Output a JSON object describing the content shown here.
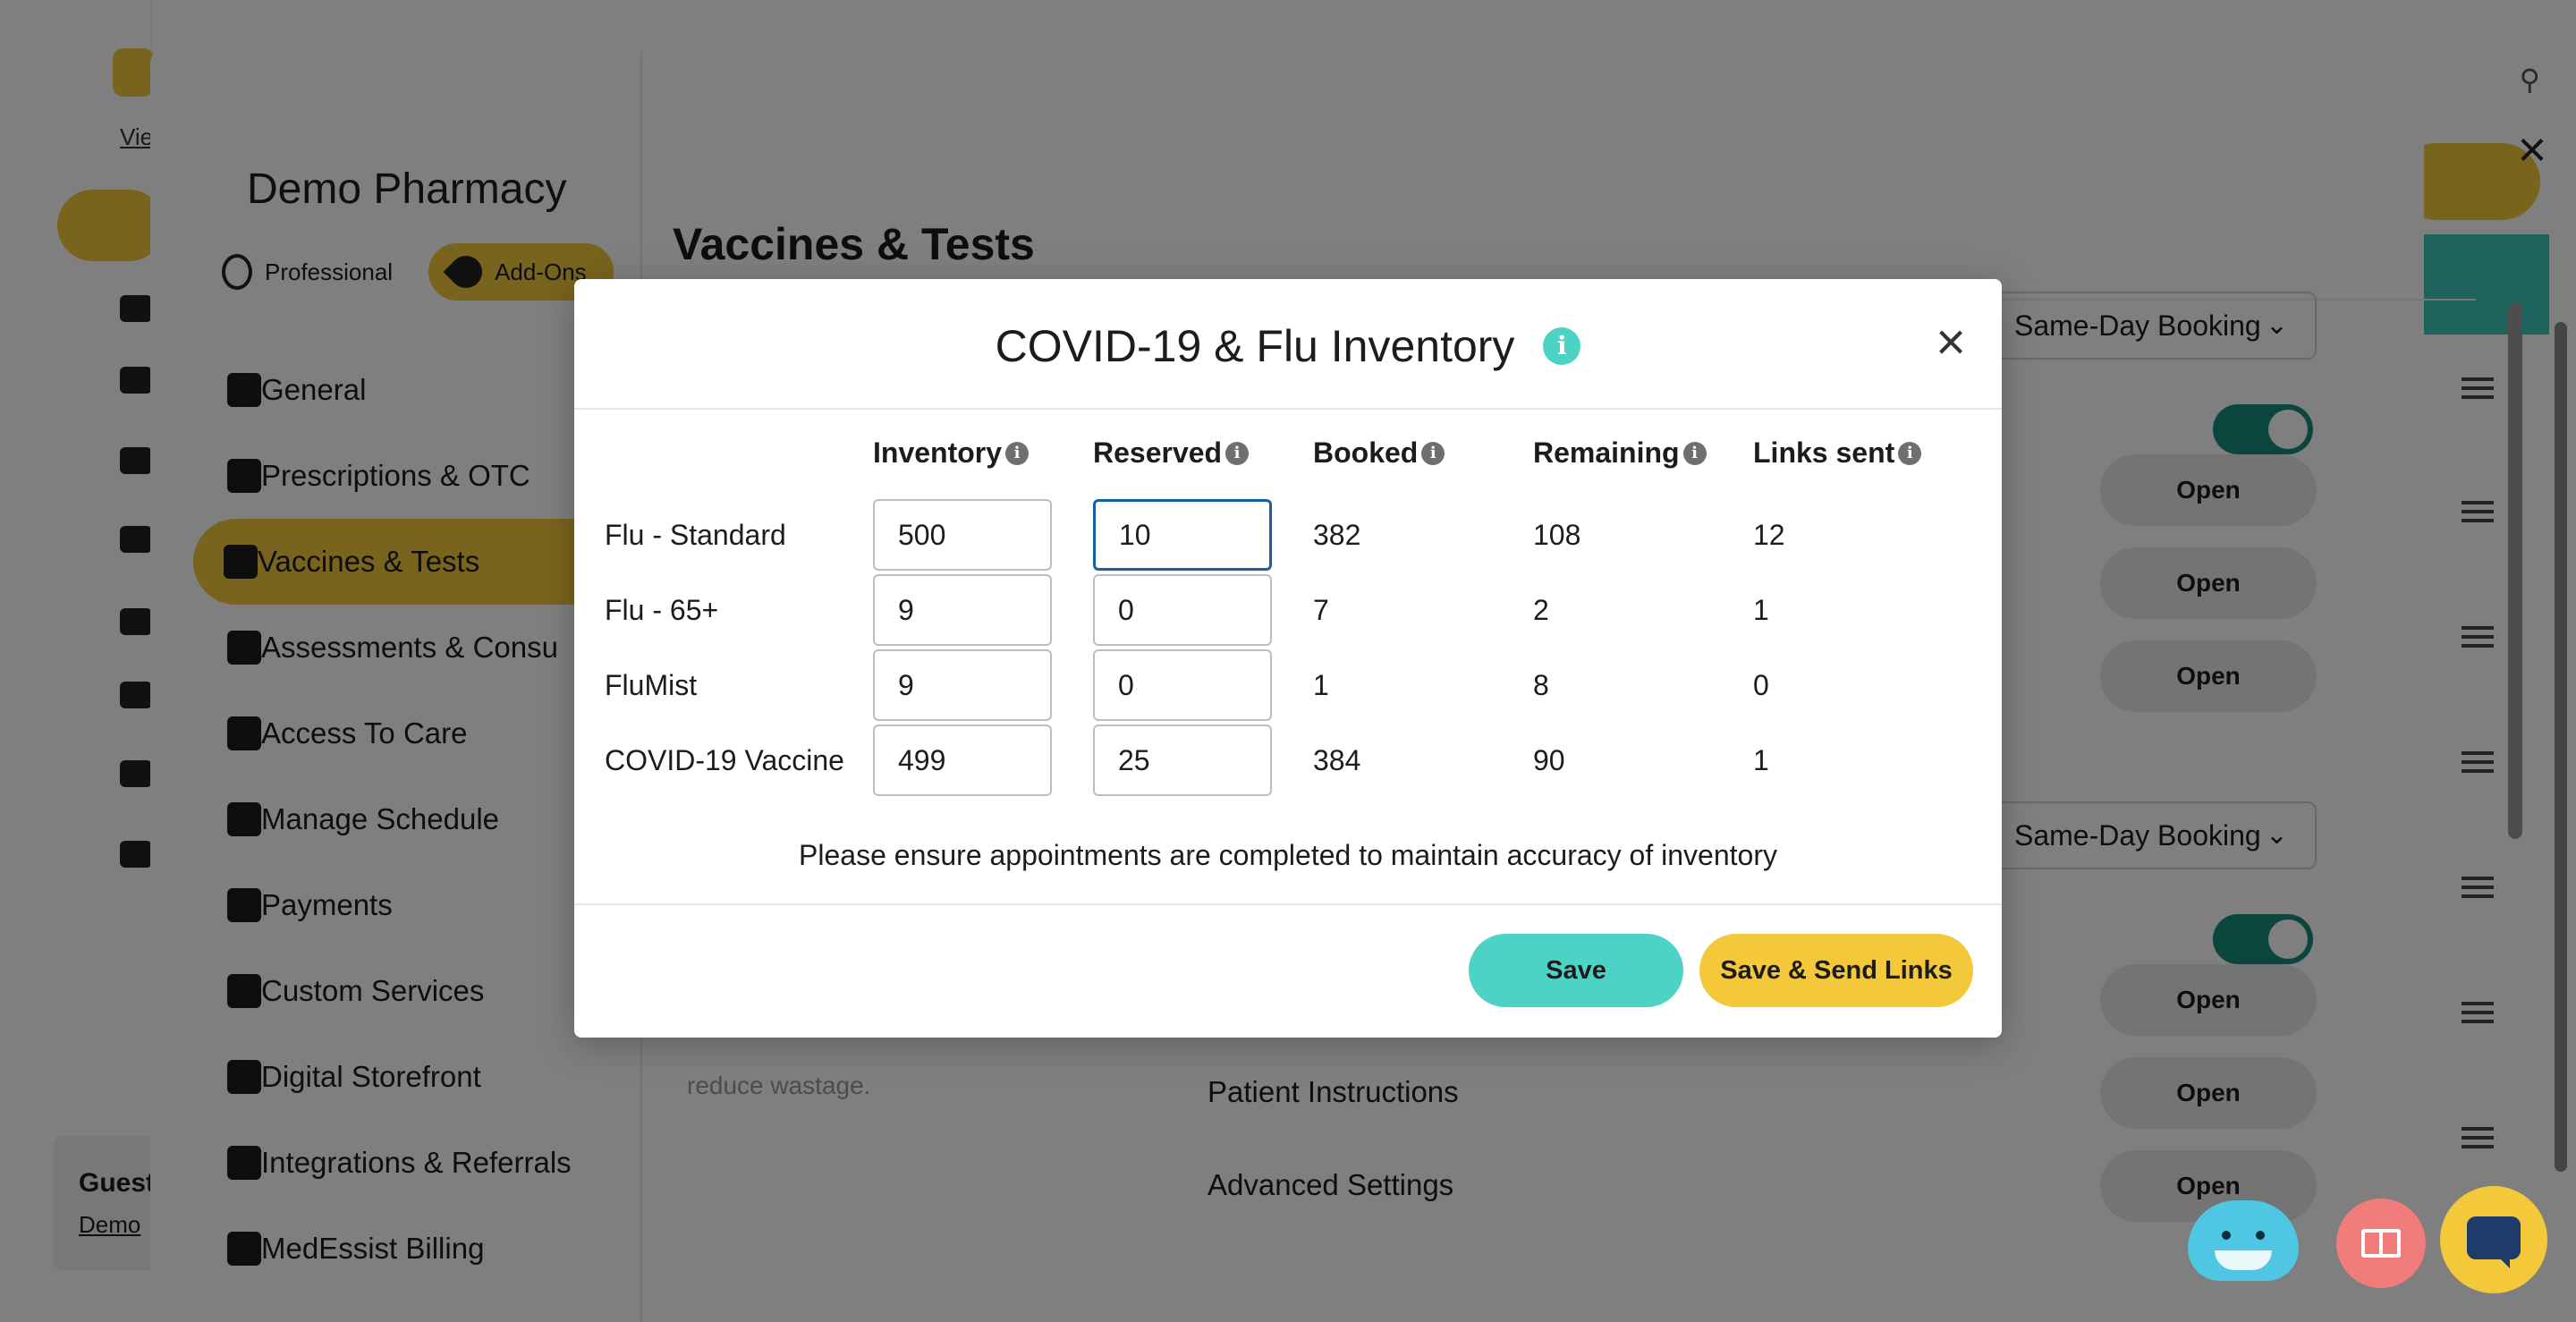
{
  "background_app": {
    "view_link": "Vie",
    "guest_label": "Guest",
    "guest_link": "Demo"
  },
  "settings_panel": {
    "pharmacy_name": "Demo Pharmacy",
    "plan_label": "Professional",
    "addons_label": "Add-Ons",
    "menu": [
      {
        "label": "General",
        "icon": "gear-icon"
      },
      {
        "label": "Prescriptions & OTC",
        "icon": "medicine-icon"
      },
      {
        "label": "Vaccines & Tests",
        "icon": "vaccine-icon"
      },
      {
        "label": "Assessments & Consu",
        "icon": "kit-icon"
      },
      {
        "label": "Access To Care",
        "icon": "people-icon"
      },
      {
        "label": "Manage Schedule",
        "icon": "calendar-icon"
      },
      {
        "label": "Payments",
        "icon": "payments-icon"
      },
      {
        "label": "Custom Services",
        "icon": "star-icon"
      },
      {
        "label": "Digital Storefront",
        "icon": "brush-icon"
      },
      {
        "label": "Integrations & Referrals",
        "icon": "send-icon"
      },
      {
        "label": "MedEssist Billing",
        "icon": "card-icon"
      }
    ],
    "active_menu": "Vaccines & Tests",
    "section_title": "Vaccines & Tests",
    "booking_dropdown_1": "Same-Day Booking",
    "booking_dropdown_2": "Same-Day Booking",
    "open_label": "Open",
    "wastage_text": "reduce wastage.",
    "patient_instructions": "Patient Instructions",
    "advanced_settings": "Advanced Settings"
  },
  "modal": {
    "title": "COVID-19 & Flu Inventory",
    "columns": [
      "Inventory",
      "Reserved",
      "Booked",
      "Remaining",
      "Links sent"
    ],
    "rows": [
      {
        "name": "Flu - Standard",
        "inventory": "500",
        "reserved": "10",
        "booked": "382",
        "remaining": "108",
        "links_sent": "12"
      },
      {
        "name": "Flu - 65+",
        "inventory": "9",
        "reserved": "0",
        "booked": "7",
        "remaining": "2",
        "links_sent": "1"
      },
      {
        "name": "FluMist",
        "inventory": "9",
        "reserved": "0",
        "booked": "1",
        "remaining": "8",
        "links_sent": "0"
      },
      {
        "name": "COVID-19 Vaccine",
        "inventory": "499",
        "reserved": "25",
        "booked": "384",
        "remaining": "90",
        "links_sent": "1"
      }
    ],
    "note": "Please ensure appointments are completed to maintain accuracy of inventory",
    "save_label": "Save",
    "save_send_label": "Save & Send Links"
  },
  "colors": {
    "accent_yellow": "#f3c83a",
    "accent_teal": "#4dd3c6",
    "toggle_on": "#148a7c",
    "focus_border": "#1b5fa3"
  }
}
